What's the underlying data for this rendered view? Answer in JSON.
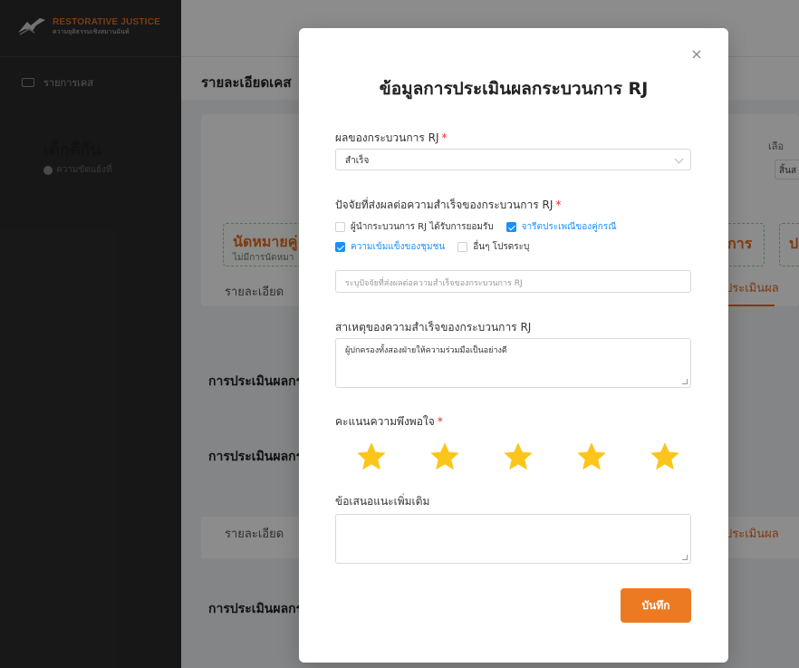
{
  "sidebar": {
    "brand_title": "RESTORATIVE JUSTICE",
    "brand_subtitle": "ความยุติธรรมเชิงสมานฉันท์",
    "items": [
      {
        "label": "รายการเคส"
      }
    ]
  },
  "background": {
    "header_title": "รายละเอียดเคส",
    "case_title": "เด็กตีกัน",
    "case_sub": "ความขัดแย้งที่",
    "right_label": "เลือ",
    "right_value": "สิ้นส",
    "box1_title": "นัดหมายคู่",
    "box1_sub": "ไม่มีการนัดหมา",
    "box2_title": "การ",
    "box3_title": "ป",
    "tab_detail": "รายละเอียด",
    "tab_eval": "ประเมินผล",
    "section_heading": "การประเมินผลกร"
  },
  "modal": {
    "title": "ข้อมูลการประเมินผลกระบวนการ RJ",
    "result_label": "ผลของกระบวนการ RJ",
    "result_value": "สำเร็จ",
    "factors_label": "ปัจจัยที่ส่งผลต่อความสำเร็จของกระบวนการ RJ",
    "factors": [
      {
        "label": "ผู้นำกระบวนการ RJ ได้รับการยอมรับ",
        "checked": false
      },
      {
        "label": "จารีตประเพณีของคู่กรณี",
        "checked": true
      },
      {
        "label": "ความเข้มแข็งของชุมชน",
        "checked": true
      },
      {
        "label": "อื่นๆ โปรดระบุ",
        "checked": false
      }
    ],
    "factor_other_placeholder": "ระบุปัจจัยที่ส่งผลต่อความสำเร็จของกระบวนการ RJ",
    "cause_label": "สาเหตุของความสำเร็จของกระบวนการ RJ",
    "cause_value": "ผู้ปกครองทั้งสองฝ่ายให้ความร่วมมือเป็นอย่างดี",
    "rating_label": "คะแนนความพึงพอใจ",
    "rating": 5,
    "rating_max": 5,
    "suggestion_label": "ข้อเสนอแนะเพิ่มเติม",
    "suggestion_value": "",
    "save_label": "บันทึก",
    "required_mark": "*",
    "close_glyph": "×"
  },
  "colors": {
    "accent": "#ec7a23",
    "checkbox": "#1890ff",
    "star": "#fbc51a",
    "required": "#f5222d"
  }
}
